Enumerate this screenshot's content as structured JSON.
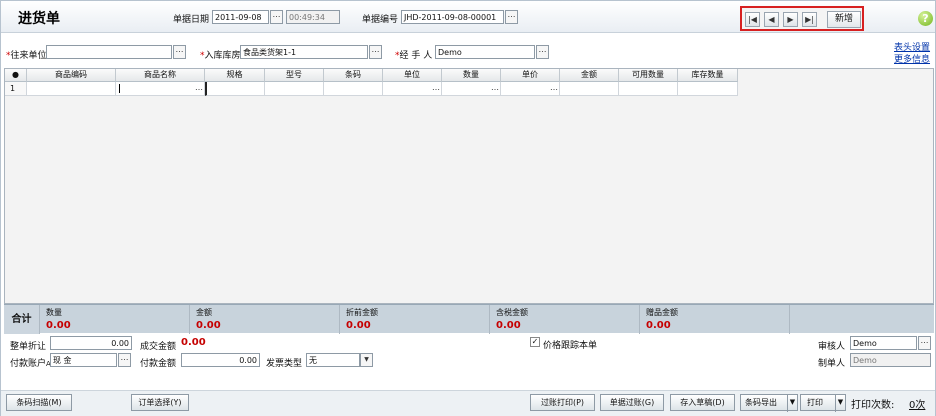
{
  "header": {
    "title": "进货单",
    "date_label": "单据日期",
    "date_value": "2011-09-08",
    "time_value": "00:49:34",
    "number_label": "单据编号",
    "number_value": "JHD-2011-09-08-00001",
    "nav": {
      "first": "|◀",
      "prev": "◀",
      "next": "▶",
      "last": "▶|",
      "new_label": "新增"
    },
    "help_icon": "?"
  },
  "form": {
    "unit_label": "往来单位",
    "unit_value": "",
    "warehouse_label": "入库库房",
    "warehouse_value": "食品类货架1-1",
    "handler_label": "经 手 人",
    "handler_value": "Demo",
    "links": {
      "header_settings": "表头设置",
      "more_info": "更多信息"
    }
  },
  "table": {
    "headers": [
      "商品编码",
      "商品名称",
      "规格",
      "型号",
      "条码",
      "单位",
      "数量",
      "单价",
      "金额",
      "可用数量",
      "库存数量"
    ],
    "row_number": "1"
  },
  "totals": {
    "label": "合计",
    "items": [
      {
        "name": "数量",
        "value": "0.00"
      },
      {
        "name": "金额",
        "value": "0.00"
      },
      {
        "name": "折前金额",
        "value": "0.00"
      },
      {
        "name": "含税金额",
        "value": "0.00"
      },
      {
        "name": "赠品金额",
        "value": "0.00"
      }
    ]
  },
  "lower": {
    "discount_label": "整单折让",
    "discount_value": "0.00",
    "deal_amount_label": "成交金额",
    "deal_amount_value": "0.00",
    "price_track_label": "价格跟踪本单",
    "pay_account_label": "付款账户",
    "pay_account_suffix": "A",
    "pay_account_value": "现     金",
    "pay_amount_label": "付款金额",
    "pay_amount_value": "0.00",
    "invoice_label": "发票类型",
    "invoice_value": "无",
    "reviewer_label": "审核人",
    "reviewer_value": "Demo",
    "creator_label": "制单人",
    "creator_value": "Demo"
  },
  "buttons": {
    "barcode_scan": "条码扫描(M)",
    "order_select": "订单选择(Y)",
    "post_print": "过账打印(P)",
    "post": "单据过账(G)",
    "save_draft": "存入草稿(D)",
    "barcode_export": "条码导出",
    "print": "打印",
    "print_count_label": "打印次数:",
    "print_count_value": "0次"
  },
  "colors": {
    "accent": "#d72020",
    "value_red": "#c50000",
    "link": "#0033aa",
    "table_bg": "#f3f3f3"
  }
}
